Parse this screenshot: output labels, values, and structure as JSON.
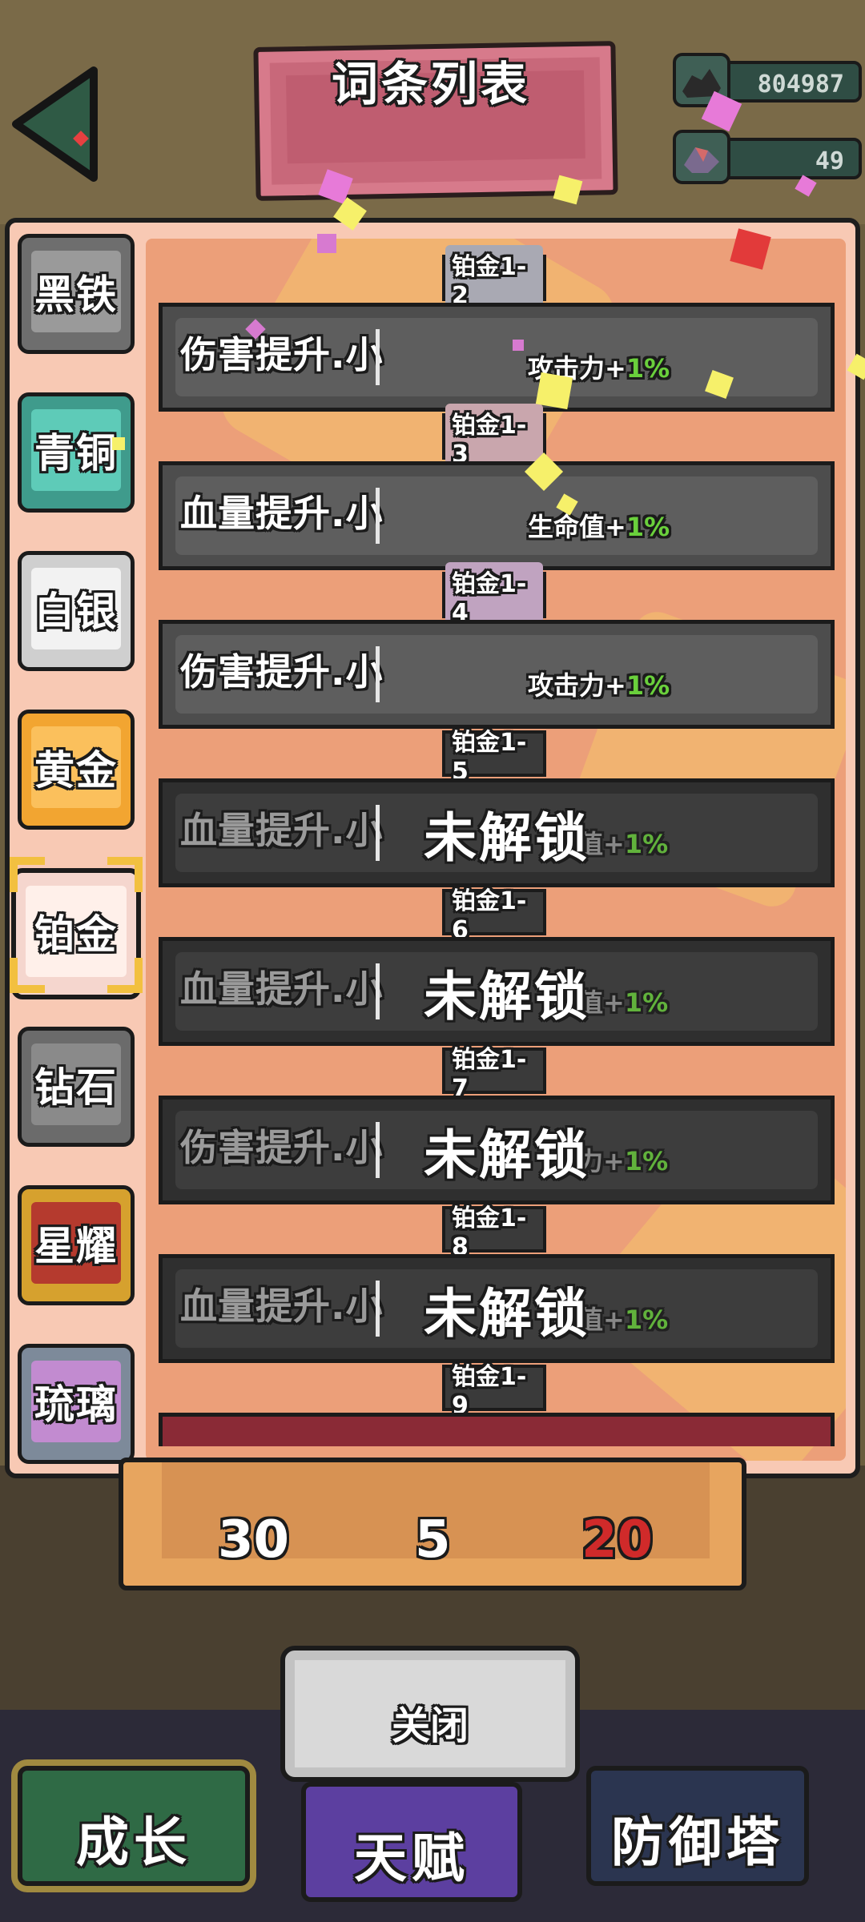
{
  "header": {
    "title": "词条列表"
  },
  "currencies": [
    {
      "icon": "ore-icon",
      "value": "804987"
    },
    {
      "icon": "gem-icon",
      "value": "49"
    }
  ],
  "tiers": [
    {
      "label": "黑铁",
      "color": "#6e6e6e",
      "face": "#9a9a9a"
    },
    {
      "label": "青铜",
      "color": "#3f9b8c",
      "face": "#5ecbb8"
    },
    {
      "label": "白银",
      "color": "#cfcfcf",
      "face": "#f2f2f2"
    },
    {
      "label": "黄金",
      "color": "#f2a531",
      "face": "#fbc05c"
    },
    {
      "label": "铂金",
      "color": "#f5d6ce",
      "face": "#fff0ea"
    },
    {
      "label": "钻石",
      "color": "#6b6b6b",
      "face": "#8a8a8a"
    },
    {
      "label": "星耀",
      "color": "#d6a12e",
      "face": "#b53a2e"
    },
    {
      "label": "琉璃",
      "color": "#7d8a9a",
      "face": "#c28bd0"
    }
  ],
  "selected_tier": "铂金",
  "entries": [
    {
      "tier": "铂金1-2",
      "name": "伤害提升.小",
      "effect": "攻击力+",
      "pct": "1%",
      "locked": false
    },
    {
      "tier": "铂金1-3",
      "name": "血量提升.小",
      "effect": "生命值+",
      "pct": "1%",
      "locked": false
    },
    {
      "tier": "铂金1-4",
      "name": "伤害提升.小",
      "effect": "攻击力+",
      "pct": "1%",
      "locked": false
    },
    {
      "tier": "铂金1-5",
      "name": "血量提升.小",
      "effect": "命值+",
      "pct": "1%",
      "locked": true
    },
    {
      "tier": "铂金1-6",
      "name": "血量提升.小",
      "effect": "命值+",
      "pct": "1%",
      "locked": true
    },
    {
      "tier": "铂金1-7",
      "name": "伤害提升.小",
      "effect": "击力+",
      "pct": "1%",
      "locked": true
    },
    {
      "tier": "铂金1-8",
      "name": "血量提升.小",
      "effect": "命值+",
      "pct": "1%",
      "locked": true
    }
  ],
  "locked_text": "未解锁",
  "next_tier_label": "铂金1-9",
  "stats": [
    {
      "value": "30",
      "color": "#ffffff"
    },
    {
      "value": "5",
      "color": "#ffffff"
    },
    {
      "value": "20",
      "color": "#d02a2a"
    }
  ],
  "close_label": "关闭",
  "nav": [
    {
      "label": "成长",
      "color": "#2f6a45",
      "face": "#3c8a58"
    },
    {
      "label": "天赋",
      "color": "#5c3fa0",
      "face": "#6e4fc0"
    },
    {
      "label": "防御塔",
      "color": "#2b3550",
      "face": "#36456a"
    }
  ]
}
